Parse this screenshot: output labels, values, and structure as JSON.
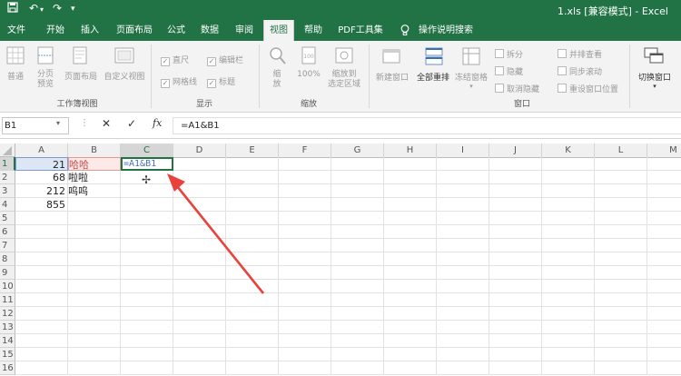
{
  "window": {
    "title": "1.xls  [兼容模式]  -  Excel"
  },
  "quick_access": {
    "save_icon": "save-icon",
    "undo_icon": "undo-icon",
    "redo_icon": "redo-icon"
  },
  "tabs": [
    "文件",
    "开始",
    "插入",
    "页面布局",
    "公式",
    "数据",
    "审阅",
    "视图",
    "帮助",
    "PDF工具集",
    "操作说明搜索"
  ],
  "ribbon": {
    "workbook_views": {
      "label": "工作簿视图",
      "normal": "普通",
      "page_break": "分页\n预览",
      "page_layout": "页面布局",
      "custom_views": "自定义视图"
    },
    "show": {
      "label": "显示",
      "ruler": "直尺",
      "formula_bar": "编辑栏",
      "gridlines": "网格线",
      "headings": "标题"
    },
    "zoom": {
      "label": "缩放",
      "zoom": "缩\n放",
      "hundred": "100%",
      "zoom_to_selection": "缩放到\n选定区域"
    },
    "window": {
      "label": "窗口",
      "new_window": "新建窗口",
      "arrange_all": "全部重排",
      "freeze_panes": "冻结窗格",
      "split": "拆分",
      "hide": "隐藏",
      "unhide": "取消隐藏",
      "view_side_by_side": "并排查看",
      "sync_scroll": "同步滚动",
      "reset_position": "重设窗口位置",
      "switch_windows": "切换窗口"
    }
  },
  "formula_bar": {
    "name_box": "B1",
    "cancel": "✕",
    "enter": "✓",
    "fx": "fx",
    "content": "=A1&B1"
  },
  "grid": {
    "columns": [
      "A",
      "B",
      "C",
      "D",
      "E",
      "F",
      "G",
      "H",
      "I",
      "J",
      "K",
      "L",
      "M"
    ],
    "rows": [
      "1",
      "2",
      "3",
      "4",
      "5",
      "6",
      "7",
      "8",
      "9",
      "10",
      "11",
      "12",
      "13",
      "14",
      "15",
      "16"
    ],
    "cells": {
      "A1": "21",
      "A2": "68",
      "A3": "212",
      "A4": "855",
      "B1": "哈哈",
      "B2": "啦啦",
      "B3": "呜呜",
      "C1": "=A1&B1"
    }
  },
  "colors": {
    "brand": "#217346",
    "arrow": "#e8423a",
    "active_cell_border": "#217346"
  }
}
